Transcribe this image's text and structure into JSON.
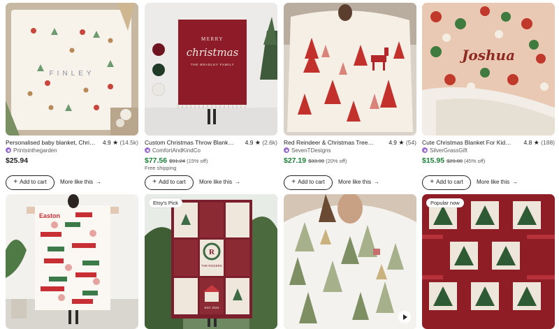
{
  "listings": [
    {
      "title": "Personalised baby blanket, Chris...",
      "rating": "4.9",
      "count": "(14.5k)",
      "shop": "Printsinthegarden",
      "price": "$25.94",
      "original_price": "",
      "discount": "",
      "shipping": "",
      "cart_label": "Add to cart",
      "more_label": "More like this",
      "image_text": "FINLEY"
    },
    {
      "title": "Custom Christmas Throw Blanke...",
      "rating": "4.9",
      "count": "(2.6k)",
      "shop": "ComfortAndKindCo",
      "price": "$77.56",
      "original_price": "$91.24",
      "discount": "(15% off)",
      "shipping": "Free shipping",
      "cart_label": "Add to cart",
      "more_label": "More like this",
      "image_text_1": "MERRY",
      "image_text_2": "christmas",
      "image_text_3": "THE BRADLEY FAMILY"
    },
    {
      "title": "Red Reindeer & Christmas Trees ...",
      "rating": "4.9",
      "count": "(54)",
      "shop": "SevenTDesigns",
      "price": "$27.19",
      "original_price": "$33.99",
      "discount": "(20% off)",
      "shipping": "",
      "cart_label": "Add to cart",
      "more_label": "More like this"
    },
    {
      "title": "Cute Christmas Blanket For Kids...",
      "rating": "4.8",
      "count": "(188)",
      "shop": "SilverGrassGift",
      "price": "$15.95",
      "original_price": "$29.00",
      "discount": "(45% off)",
      "shipping": "",
      "cart_label": "Add to cart",
      "more_label": "More like this",
      "image_text": "Joshua"
    },
    {
      "image_text": "Easton"
    },
    {
      "badge": "Etsy's Pick",
      "image_text_1": "R",
      "image_text_2": "THE ROGERS",
      "image_text_3": "EST. 2019"
    },
    {
      "has_video": true
    },
    {
      "badge": "Popular now"
    }
  ],
  "colors": {
    "sale_green": "#1a7f37",
    "shop_badge": "#9b6fd1",
    "text": "#222222",
    "muted": "#595959"
  },
  "icons": {
    "star": "★",
    "arrow": "→",
    "plus": "+"
  }
}
